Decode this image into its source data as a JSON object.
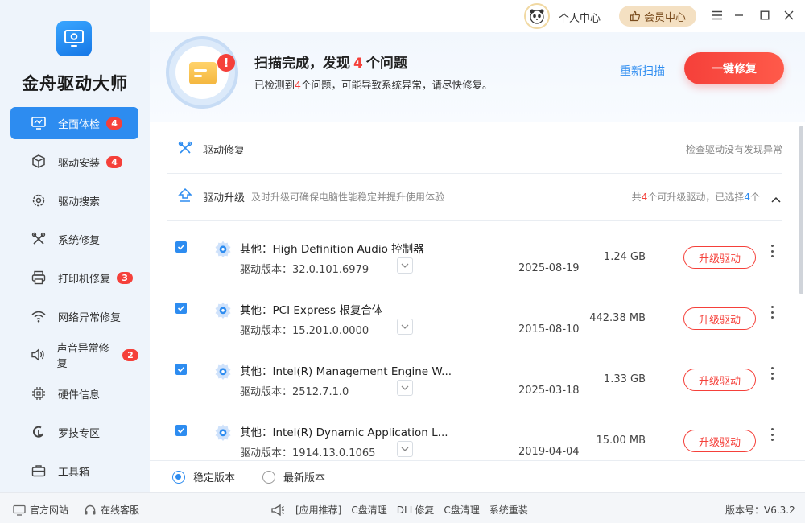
{
  "app": {
    "title": "金舟驱动大师"
  },
  "topbar": {
    "user_center": "个人中心",
    "vip_center": "会员中心"
  },
  "sidebar": {
    "items": [
      {
        "label": "全面体检",
        "badge": "4",
        "icon": "monitor-icon",
        "active": true
      },
      {
        "label": "驱动安装",
        "badge": "4",
        "icon": "package-icon"
      },
      {
        "label": "驱动搜索",
        "badge": "",
        "icon": "search-gear-icon"
      },
      {
        "label": "系统修复",
        "badge": "",
        "icon": "tools-icon"
      },
      {
        "label": "打印机修复",
        "badge": "3",
        "icon": "printer-icon"
      },
      {
        "label": "网络异常修复",
        "badge": "",
        "icon": "wifi-icon"
      },
      {
        "label": "声音异常修复",
        "badge": "2",
        "icon": "speaker-icon"
      },
      {
        "label": "硬件信息",
        "badge": "",
        "icon": "chip-icon"
      },
      {
        "label": "罗技专区",
        "badge": "",
        "icon": "logitech-icon"
      },
      {
        "label": "工具箱",
        "badge": "",
        "icon": "toolbox-icon"
      }
    ]
  },
  "header": {
    "title_prefix": "扫描完成，发现",
    "count": "4",
    "title_suffix": "个问题",
    "sub_prefix": "已检测到",
    "sub_count": "4",
    "sub_suffix": "个问题，可能导致系统异常，请尽快修复。",
    "rescan": "重新扫描",
    "fix_all": "一键修复"
  },
  "sections": {
    "repair": {
      "title": "驱动修复",
      "status": "检查驱动没有发现异常"
    },
    "upgrade": {
      "title": "驱动升级",
      "desc": "及时升级可确保电脑性能稳定并提升使用体验",
      "summary_prefix": "共",
      "summary_total": "4",
      "summary_mid": "个可升级驱动，已选择",
      "summary_selected": "4",
      "summary_suffix": "个"
    }
  },
  "drivers": [
    {
      "name": "其他：High Definition Audio 控制器",
      "version": "驱动版本：32.0.101.6979",
      "date": "2025-08-19",
      "size": "1.24 GB",
      "action": "升级驱动"
    },
    {
      "name": "其他：PCI Express 根复合体",
      "version": "驱动版本：15.201.0.0000",
      "date": "2015-08-10",
      "size": "442.38 MB",
      "action": "升级驱动"
    },
    {
      "name": "其他：Intel(R) Management Engine W...",
      "version": "驱动版本：2512.7.1.0",
      "date": "2025-03-18",
      "size": "1.33 GB",
      "action": "升级驱动"
    },
    {
      "name": "其他：Intel(R) Dynamic Application L...",
      "version": "驱动版本：1914.13.0.1065",
      "date": "2019-04-04",
      "size": "15.00 MB",
      "action": "升级驱动"
    }
  ],
  "version_choice": {
    "stable": "稳定版本",
    "latest": "最新版本",
    "selected": "stable"
  },
  "footer": {
    "website": "官方网站",
    "support": "在线客服",
    "promo_label": "[应用推荐]",
    "links": [
      "C盘清理",
      "DLL修复",
      "C盘清理",
      "系统重装"
    ],
    "version": "版本号：V6.3.2"
  },
  "colors": {
    "accent": "#2d8cf0",
    "danger": "#f5403a",
    "vip": "#f4e0c2"
  }
}
